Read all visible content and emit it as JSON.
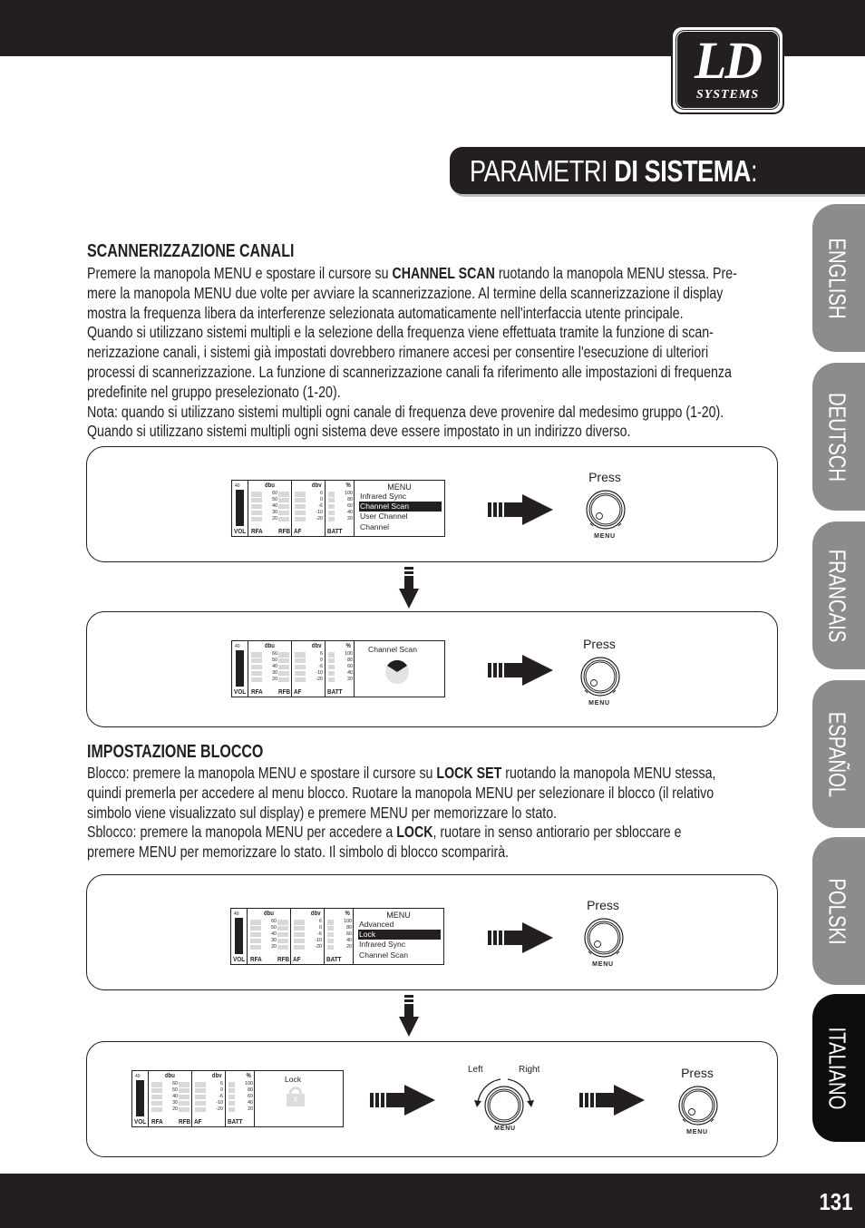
{
  "header": {
    "logo": {
      "main": "LD",
      "sub": "SYSTEMS"
    },
    "title_light": "PARAMETRI ",
    "title_bold": "DI SISTEMA",
    "title_suffix": ":"
  },
  "language_tabs": [
    {
      "label": "ENGLISH",
      "active": false
    },
    {
      "label": "DEUTSCH",
      "active": false
    },
    {
      "label": "FRANCAIS",
      "active": false
    },
    {
      "label": "ESPAÑOL",
      "active": false
    },
    {
      "label": "POLSKI",
      "active": false
    },
    {
      "label": "ITALIANO",
      "active": true
    }
  ],
  "section1": {
    "title": "SCANNERIZZAZIONE CANALI",
    "lines": [
      {
        "pre": "Premere la manopola MENU e spostare il cursore su ",
        "bold": "CHANNEL SCAN",
        "post": " ruotando la manopola MENU stessa. Pre-"
      },
      {
        "pre": "mere la manopola MENU due volte per avviare la scannerizzazione. Al termine della scannerizzazione il display"
      },
      {
        "pre": "mostra la frequenza libera da interferenze selezionata automaticamente nell'interfaccia utente principale."
      },
      {
        "pre": "Quando si utilizzano sistemi multipli e la selezione della frequenza viene effettuata tramite la funzione di scan-"
      },
      {
        "pre": "nerizzazione canali, i sistemi già impostati dovrebbero rimanere accesi per consentire l'esecuzione di ulteriori"
      },
      {
        "pre": "processi di scannerizzazione. La funzione di scannerizzazione canali fa riferimento alle impostazioni di frequenza"
      },
      {
        "pre": "predefinite nel gruppo preselezionato (1-20)."
      },
      {
        "pre": "Nota: quando si utilizzano sistemi multipli ogni canale di frequenza deve provenire dal medesimo gruppo (1-20)."
      },
      {
        "pre": "Quando si utilizzano sistemi multipli ogni sistema deve essere impostato in un indirizzo diverso."
      }
    ]
  },
  "section2": {
    "title": "IMPOSTAZIONE BLOCCO",
    "lines": [
      {
        "pre": "Blocco: premere la manopola MENU e spostare il cursore su ",
        "bold": "LOCK SET",
        "post": " ruotando la manopola MENU stessa,"
      },
      {
        "pre": "quindi premerla per accedere al menu blocco. Ruotare la manopola MENU per selezionare il blocco (il relativo"
      },
      {
        "pre": "simbolo viene visualizzato sul display) e premere MENU per memorizzare lo stato."
      },
      {
        "pre": "Sblocco: premere la manopola MENU per accedere a ",
        "bold": "LOCK",
        "post": ", ruotare in senso antiorario per sbloccare e"
      },
      {
        "pre": "premere MENU per memorizzare lo stato. Il simbolo di blocco scomparirà."
      }
    ]
  },
  "display_common": {
    "vol_value": "40",
    "vol_label": "VOL",
    "dbu_header": "dbu",
    "dbu_ticks": [
      "60",
      "50",
      "40",
      "30",
      "20"
    ],
    "rfa_label": "RFA",
    "rfb_label": "RFB",
    "dbv_header": "dbv",
    "dbv_ticks": [
      "6",
      "0",
      "-6",
      "-10",
      "-20"
    ],
    "af_label": "AF",
    "pct_header": "%",
    "pct_ticks": [
      "100",
      "80",
      "60",
      "40",
      "20"
    ],
    "batt_label": "BATT"
  },
  "diagrams": {
    "d1": {
      "menu_title": "MENU",
      "items": [
        "Infrared Sync",
        "Channel Scan",
        "User Channel",
        "Channel"
      ],
      "selected": 1,
      "knob_action": "Press",
      "knob_label": "MENU"
    },
    "d2": {
      "screen_title": "Channel Scan",
      "knob_action": "Press",
      "knob_label": "MENU"
    },
    "d3": {
      "menu_title": "MENU",
      "items": [
        "Advanced",
        "Lock",
        "Infrared Sync",
        "Channel Scan"
      ],
      "selected": 1,
      "knob_action": "Press",
      "knob_label": "MENU"
    },
    "d4": {
      "screen_title": "Lock",
      "lock_glyph": "X",
      "rotate_left": "Left",
      "rotate_right": "Right",
      "rotate_knob_label": "MENU",
      "knob_action": "Press",
      "knob_label": "MENU"
    }
  },
  "footer": {
    "page_number": "131"
  }
}
